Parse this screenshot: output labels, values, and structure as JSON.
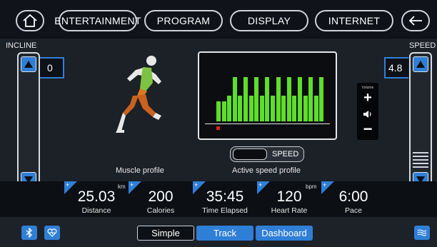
{
  "nav": {
    "home_icon": "home-icon",
    "back_icon": "back-arrow-icon",
    "tabs": [
      {
        "label": "ENTERTAINMENT"
      },
      {
        "label": "PROGRAM"
      },
      {
        "label": "DISPLAY"
      },
      {
        "label": "INTERNET"
      }
    ]
  },
  "incline": {
    "label": "INCLINE",
    "value": "0"
  },
  "speed": {
    "label": "SPEED",
    "value": "4.8"
  },
  "muscle_profile": {
    "label": "Muscle profile"
  },
  "speed_profile": {
    "label": "Active speed profile",
    "toggle_label": "SPEED",
    "bars": [
      0.28,
      0.28,
      0.36,
      0.62,
      0.36,
      0.62,
      0.36,
      0.62,
      0.36,
      0.62,
      0.36,
      0.62,
      0.36,
      0.62,
      0.36,
      0.62,
      0.36,
      0.62,
      0.36,
      0.62
    ],
    "position": 1
  },
  "volume": {
    "label": "Volume",
    "plus": "+",
    "minus": "−"
  },
  "stats": [
    {
      "value": "25.03",
      "unit": "km",
      "label": "Distance"
    },
    {
      "value": "200",
      "unit": "",
      "label": "Calories"
    },
    {
      "value": "35:45",
      "unit": "",
      "label": "Time Elapsed"
    },
    {
      "value": "120",
      "unit": "bpm",
      "label": "Heart Rate"
    },
    {
      "value": "6:00",
      "unit": "",
      "label": "Pace"
    }
  ],
  "stat_plus": "+",
  "modes": [
    {
      "label": "Simple"
    },
    {
      "label": "Track"
    },
    {
      "label": "Dashboard"
    }
  ],
  "colors": {
    "accent": "#2f7fd6",
    "bar": "#5ede2b",
    "marker": "#e0201c"
  }
}
